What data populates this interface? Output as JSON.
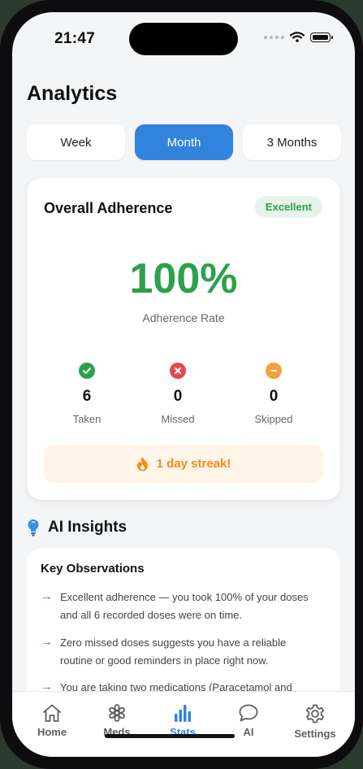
{
  "status_bar": {
    "time": "21:47"
  },
  "page": {
    "title": "Analytics"
  },
  "period_tabs": [
    {
      "label": "Week",
      "active": false
    },
    {
      "label": "Month",
      "active": true
    },
    {
      "label": "3 Months",
      "active": false
    }
  ],
  "adherence": {
    "title": "Overall Adherence",
    "badge": "Excellent",
    "rate": "100%",
    "rate_label": "Adherence Rate",
    "stats": [
      {
        "icon": "check-circle-icon",
        "value": "6",
        "label": "Taken",
        "color": "#2ea04c"
      },
      {
        "icon": "x-circle-icon",
        "value": "0",
        "label": "Missed",
        "color": "#e5484d"
      },
      {
        "icon": "minus-circle-icon",
        "value": "0",
        "label": "Skipped",
        "color": "#f5a03a"
      }
    ],
    "streak": "1 day streak!"
  },
  "ai": {
    "title": "AI Insights",
    "section_title": "Key Observations",
    "observations": [
      "Excellent adherence — you took 100% of your doses and all 6 recorded doses were on time.",
      "Zero missed doses suggests you have a reliable routine or good reminders in place right now.",
      "You are taking two medications (Paracetamol and"
    ]
  },
  "tabbar": [
    {
      "label": "Home",
      "icon": "home-icon",
      "active": false
    },
    {
      "label": "Meds",
      "icon": "medical-star-icon",
      "active": false
    },
    {
      "label": "Stats",
      "icon": "bar-chart-icon",
      "active": true
    },
    {
      "label": "AI",
      "icon": "chat-bubble-icon",
      "active": false
    },
    {
      "label": "Settings",
      "icon": "gear-icon",
      "active": false
    }
  ],
  "colors": {
    "accent": "#3283dc",
    "success": "#2ea04c",
    "danger": "#e5484d",
    "warning": "#f5a03a",
    "streak": "#f28c1e"
  }
}
